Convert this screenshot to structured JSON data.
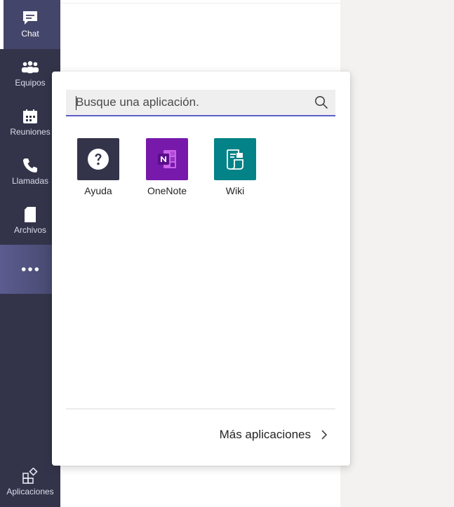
{
  "rail": {
    "items": [
      {
        "id": "chat",
        "label": "Chat",
        "icon": "chat-icon"
      },
      {
        "id": "teams",
        "label": "Equipos",
        "icon": "teams-icon"
      },
      {
        "id": "meetings",
        "label": "Reuniones",
        "icon": "calendar-icon"
      },
      {
        "id": "calls",
        "label": "Llamadas",
        "icon": "phone-icon"
      },
      {
        "id": "files",
        "label": "Archivos",
        "icon": "file-icon"
      },
      {
        "id": "more",
        "label": "",
        "icon": "more-icon"
      }
    ],
    "apps_label": "Aplicaciones",
    "apps_icon": "apps-icon"
  },
  "popup": {
    "search_placeholder": "Busque una aplicación.",
    "apps": [
      {
        "name": "Ayuda",
        "icon": "help-icon",
        "color": "#33344a"
      },
      {
        "name": "OneNote",
        "icon": "onenote-icon",
        "color": "#7719aa"
      },
      {
        "name": "Wiki",
        "icon": "wiki-icon",
        "color": "#038387"
      }
    ],
    "more_apps_label": "Más aplicaciones"
  }
}
